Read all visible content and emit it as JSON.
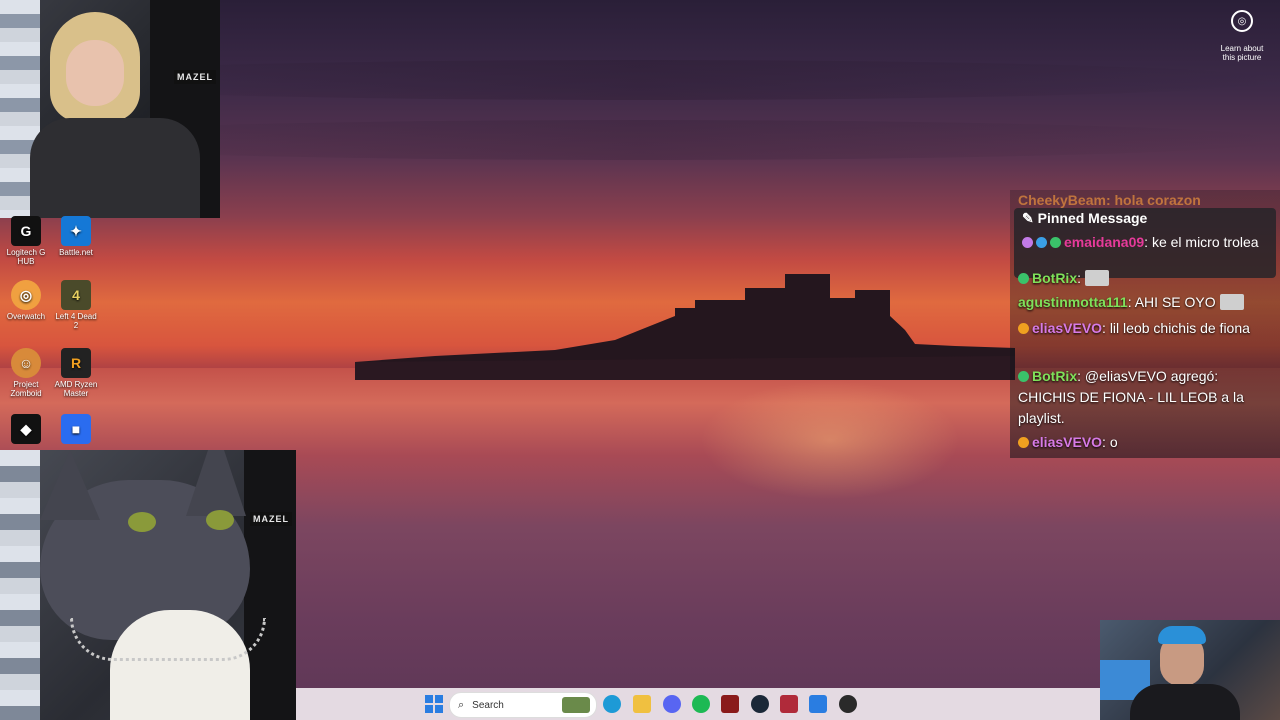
{
  "desktop": {
    "icons": [
      {
        "label": "Logitech G HUB",
        "glyph": "G",
        "bg": "#111111",
        "fg": "#ffffff"
      },
      {
        "label": "Battle.net",
        "glyph": "✦",
        "bg": "#1578d6",
        "fg": "#ffffff"
      },
      {
        "label": "Overwatch",
        "glyph": "◎",
        "bg": "#f0a040",
        "fg": "#ffffff"
      },
      {
        "label": "Left 4 Dead 2",
        "glyph": "4",
        "bg": "#4a4a2a",
        "fg": "#e8d060"
      },
      {
        "label": "Project Zomboid",
        "glyph": "☺",
        "bg": "#d88a3a",
        "fg": "#ffffff"
      },
      {
        "label": "AMD Ryzen Master",
        "glyph": "R",
        "bg": "#222222",
        "fg": "#f0a020"
      },
      {
        "label": "",
        "glyph": "◆",
        "bg": "#111111",
        "fg": "#ffffff"
      },
      {
        "label": "",
        "glyph": "■",
        "bg": "#2a6cf0",
        "fg": "#ffffff"
      }
    ]
  },
  "spotlight": {
    "label": "Learn about this picture"
  },
  "webcams": {
    "top_banner": "MAZEL",
    "cat_banner": "MAZEL"
  },
  "chat": {
    "faded_line": "CheekyBeam: hola corazon",
    "pinned": {
      "title": "Pinned Message",
      "user": "emaidana09",
      "text": ": ke el micro trolea"
    },
    "messages": [
      {
        "user": "BotRix",
        "text": ":"
      },
      {
        "user": "agustinmotta111",
        "text": ": AHI SE OYO"
      },
      {
        "user": "eliasVEVO",
        "text": ": lil leob chichis de fiona"
      },
      {
        "user": "BotRix",
        "text": ": @eliasVEVO agregó: CHICHIS DE FIONA - LIL LEOB a la playlist."
      },
      {
        "user": "eliasVEVO",
        "text": ": o"
      }
    ]
  },
  "taskbar": {
    "search_placeholder": "Search"
  },
  "colors": {
    "accent_green": "#7fe15a",
    "accent_pink": "#d77ae6",
    "taskbar_bg": "#f0e8ee"
  }
}
